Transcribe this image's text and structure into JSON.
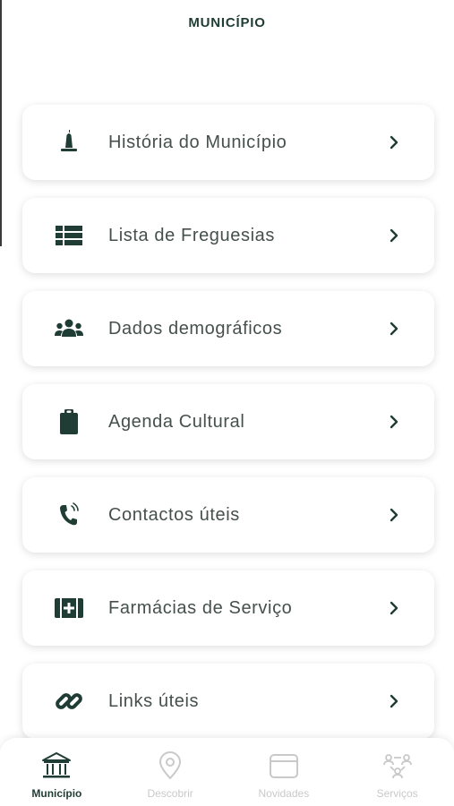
{
  "header": {
    "title": "MUNICÍPIO"
  },
  "colors": {
    "primary": "#1f3d35",
    "text": "#45504c",
    "inactive": "#c9c9c9"
  },
  "menu": {
    "items": [
      {
        "label": "História do Município",
        "icon": "monument-icon"
      },
      {
        "label": "Lista de Freguesias",
        "icon": "list-icon"
      },
      {
        "label": "Dados demográficos",
        "icon": "users-icon"
      },
      {
        "label": "Agenda Cultural",
        "icon": "clipboard-icon"
      },
      {
        "label": "Contactos úteis",
        "icon": "phone-icon"
      },
      {
        "label": "Farmácias de Serviço",
        "icon": "medkit-icon"
      },
      {
        "label": "Links úteis",
        "icon": "link-icon"
      }
    ]
  },
  "tabbar": {
    "tabs": [
      {
        "label": "Município",
        "icon": "bank-icon",
        "active": true
      },
      {
        "label": "Descobrir",
        "icon": "map-pin-icon",
        "active": false
      },
      {
        "label": "Novidades",
        "icon": "card-icon",
        "active": false
      },
      {
        "label": "Serviços",
        "icon": "network-icon",
        "active": false
      }
    ]
  }
}
